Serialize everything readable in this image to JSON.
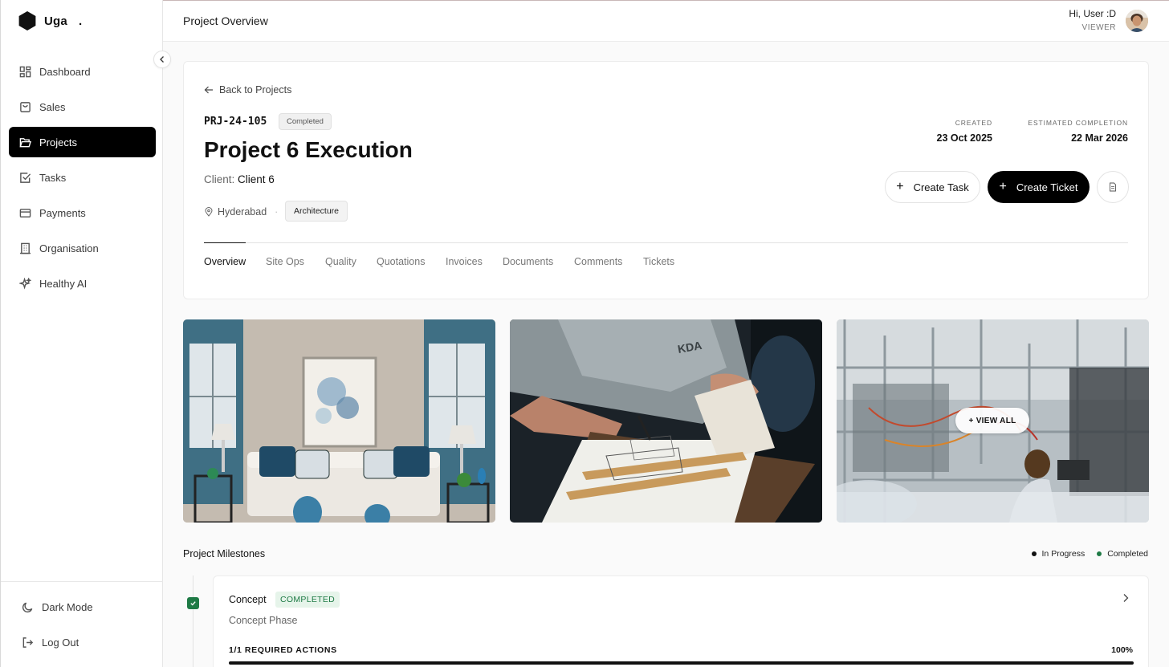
{
  "brand": {
    "name": "Uga",
    "dot": "."
  },
  "sidebar": {
    "items": [
      {
        "label": "Dashboard",
        "icon": "dashboard-icon",
        "active": false
      },
      {
        "label": "Sales",
        "icon": "shopping-bag-icon",
        "active": false
      },
      {
        "label": "Projects",
        "icon": "folder-open-icon",
        "active": true
      },
      {
        "label": "Tasks",
        "icon": "checkbox-icon",
        "active": false
      },
      {
        "label": "Payments",
        "icon": "credit-card-icon",
        "active": false
      },
      {
        "label": "Organisation",
        "icon": "building-icon",
        "active": false
      },
      {
        "label": "Healthy AI",
        "icon": "sparkles-icon",
        "active": false
      }
    ],
    "bottom": [
      {
        "label": "Dark Mode",
        "icon": "moon-icon"
      },
      {
        "label": "Log Out",
        "icon": "logout-icon"
      }
    ]
  },
  "header": {
    "title": "Project Overview",
    "greeting": "Hi, User :D",
    "role": "VIEWER"
  },
  "project": {
    "back_label": "Back to Projects",
    "id": "PRJ-24-105",
    "status": "Completed",
    "title": "Project 6 Execution",
    "client_label": "Client:",
    "client": "Client 6",
    "location": "Hyderabad",
    "separator": "·",
    "category": "Architecture",
    "created_label": "CREATED",
    "created": "23 Oct 2025",
    "est_label": "ESTIMATED COMPLETION",
    "est": "22 Mar 2026"
  },
  "actions": {
    "create_task": "Create Task",
    "create_ticket": "Create Ticket",
    "plus": "+"
  },
  "tabs": [
    "Overview",
    "Site Ops",
    "Quality",
    "Quotations",
    "Invoices",
    "Documents",
    "Comments",
    "Tickets"
  ],
  "gallery": {
    "view_all": "+ VIEW ALL"
  },
  "milestones": {
    "title": "Project Milestones",
    "legend": [
      {
        "label": "In Progress",
        "color": "#111111"
      },
      {
        "label": "Completed",
        "color": "#1e7a45"
      }
    ],
    "items": [
      {
        "name": "Concept",
        "status": "COMPLETED",
        "phase": "Concept Phase",
        "required": "1/1 REQUIRED ACTIONS",
        "percent_label": "100%",
        "progress": 1.0
      }
    ]
  },
  "colors": {
    "accent": "#000000",
    "success": "#1e7a45",
    "success_bg": "#e6f4ea"
  }
}
